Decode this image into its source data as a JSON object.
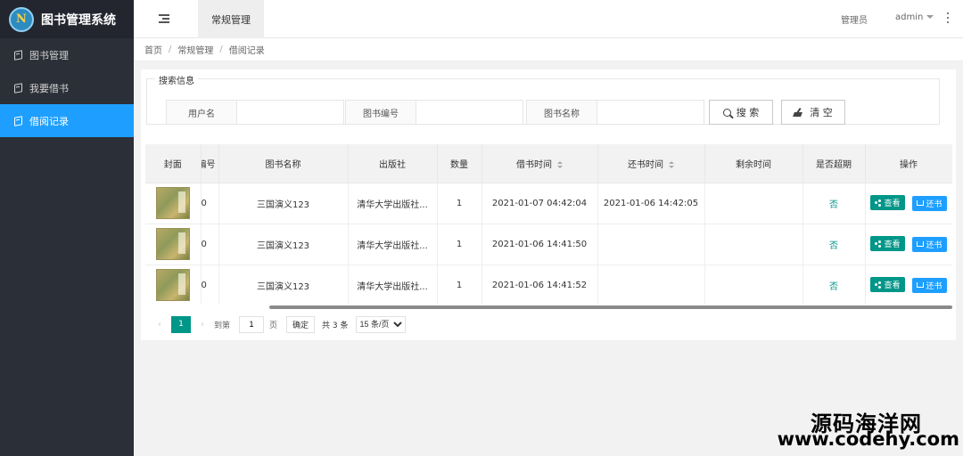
{
  "app": {
    "logo_glyph": "N",
    "title": "图书管理系统"
  },
  "sidebar": {
    "items": [
      {
        "label": "图书管理",
        "icon": "book-icon",
        "active": false
      },
      {
        "label": "我要借书",
        "icon": "book-icon",
        "active": false
      },
      {
        "label": "借阅记录",
        "icon": "book-icon",
        "active": true
      }
    ]
  },
  "header": {
    "tab": "常规管理",
    "role": "管理员",
    "user": "admin"
  },
  "breadcrumb": [
    "首页",
    "常规管理",
    "借阅记录"
  ],
  "search": {
    "legend": "搜索信息",
    "fields": [
      {
        "label": "用户名",
        "value": ""
      },
      {
        "label": "图书编号",
        "value": ""
      },
      {
        "label": "图书名称",
        "value": ""
      }
    ],
    "search_label": "搜 索",
    "clear_label": "清 空"
  },
  "table": {
    "columns": [
      "封面",
      "编号",
      "图书名称",
      "出版社",
      "数量",
      "借书时间",
      "还书时间",
      "剩余时间",
      "是否超期",
      "操作"
    ],
    "rows": [
      {
        "id": "0",
        "name": "三国演义123",
        "publisher": "清华大学出版社...",
        "qty": "1",
        "borrow_time": "2021-01-07 04:42:04",
        "return_time": "2021-01-06 14:42:05",
        "remaining": "",
        "overdue": "否"
      },
      {
        "id": "0",
        "name": "三国演义123",
        "publisher": "清华大学出版社...",
        "qty": "1",
        "borrow_time": "2021-01-06 14:41:50",
        "return_time": "",
        "remaining": "",
        "overdue": "否"
      },
      {
        "id": "0",
        "name": "三国演义123",
        "publisher": "清华大学出版社...",
        "qty": "1",
        "borrow_time": "2021-01-06 14:41:52",
        "return_time": "",
        "remaining": "",
        "overdue": "否"
      }
    ],
    "view_label": "查看",
    "return_label": "还书"
  },
  "pager": {
    "current": "1",
    "goto_prefix": "到第",
    "goto_value": "1",
    "goto_suffix": "页",
    "confirm": "确定",
    "total": "共 3 条",
    "page_size": "15 条/页"
  },
  "watermark": {
    "line1": "源码海洋网",
    "line2": "www.codehy.com"
  },
  "colors": {
    "sidebar_bg": "#2b2f38",
    "active": "#1e9fff",
    "teal": "#009688"
  }
}
